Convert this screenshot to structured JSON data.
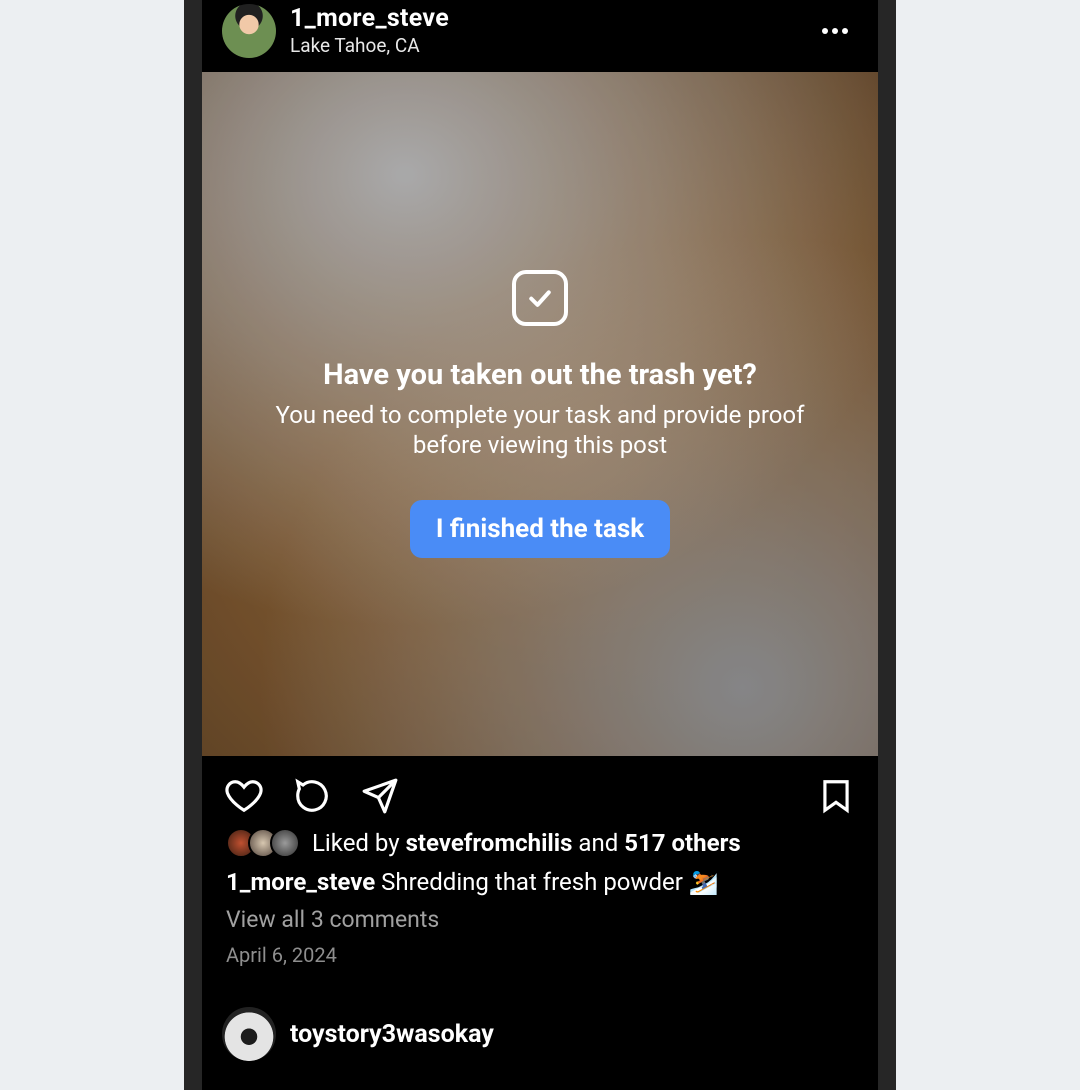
{
  "post1": {
    "username": "1_more_steve",
    "location": "Lake Tahoe, CA",
    "overlay": {
      "title": "Have you taken out the trash yet?",
      "subtitle": "You need to complete your task and provide proof before viewing this post",
      "button": "I finished the task"
    },
    "likes": {
      "prefix": "Liked by ",
      "first_liker": "stevefromchilis",
      "middle": " and ",
      "others": "517 others"
    },
    "caption_user": "1_more_steve",
    "caption_text": " Shredding that fresh powder ⛷️",
    "comments_link": "View all 3 comments",
    "date": "April 6, 2024"
  },
  "post2": {
    "username": "toystory3wasokay"
  }
}
